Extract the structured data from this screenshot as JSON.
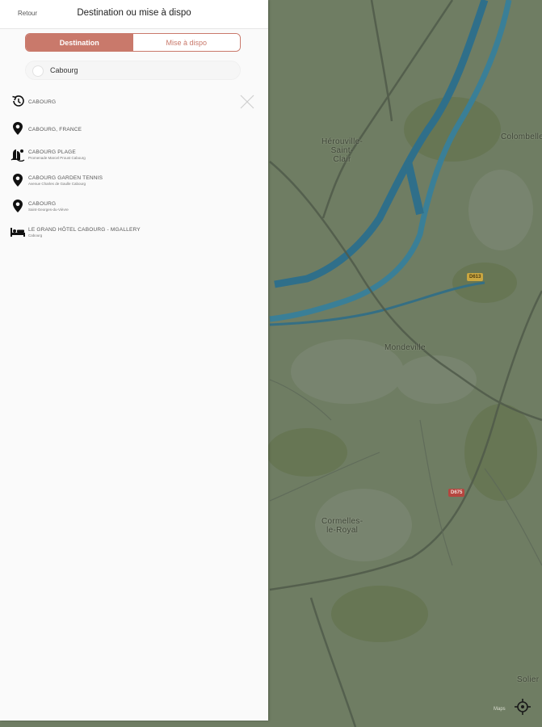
{
  "header": {
    "back_label": "Retour",
    "title": "Destination ou mise à dispo"
  },
  "tabs": [
    {
      "label": "Destination",
      "active": true
    },
    {
      "label": "Mise à dispo",
      "active": false
    }
  ],
  "search": {
    "value": "Cabourg"
  },
  "results": [
    {
      "icon": "history-icon",
      "title": "CABOURG",
      "subtitle": ""
    },
    {
      "icon": "location-pin-icon",
      "title": "CABOURG, FRANCE",
      "subtitle": ""
    },
    {
      "icon": "beach-icon",
      "title": "CABOURG PLAGE",
      "subtitle": "Promenade Marcel Proust Cabourg"
    },
    {
      "icon": "location-pin-icon",
      "title": "CABOURG GARDEN TENNIS",
      "subtitle": "Avenue Charles de Gaulle Cabourg"
    },
    {
      "icon": "location-pin-icon",
      "title": "CABOURG",
      "subtitle": "Saint-Georges-du-Vièvre"
    },
    {
      "icon": "hotel-bed-icon",
      "title": "LE GRAND HÔTEL CABOURG - MGALLERY",
      "subtitle": "Cabourg"
    }
  ],
  "map": {
    "labels": {
      "herouville": "Hérouville-\nSaint-\nClair",
      "colombelles": "Colombelles",
      "mondeville": "Mondeville",
      "cormelles": "Cormelles-\nle-Royal",
      "soliers": "Solier"
    },
    "road_badges": {
      "d613": "D613",
      "d675": "D675"
    },
    "attribution": "Maps",
    "colors": {
      "accent": "#c9796b",
      "water": "#2f6f8a",
      "map_base": "#6f7d63"
    }
  }
}
